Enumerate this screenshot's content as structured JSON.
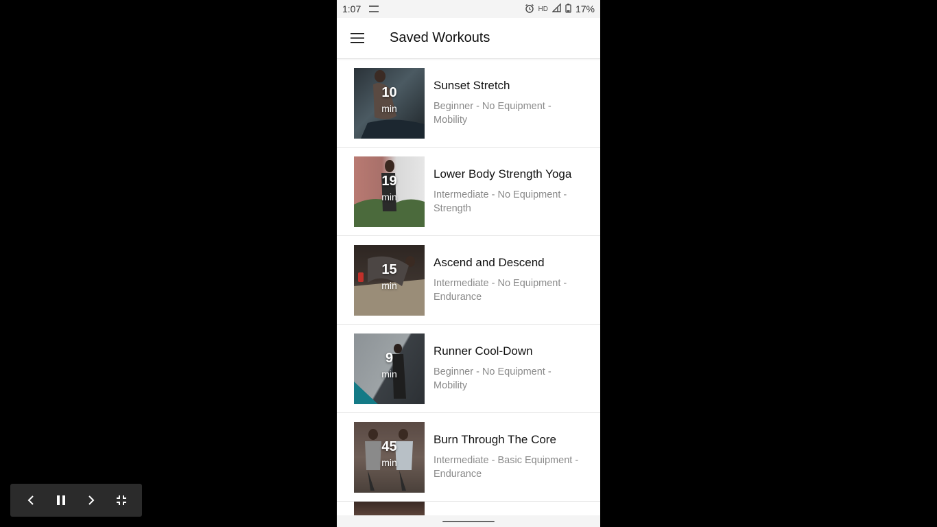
{
  "status_bar": {
    "time": "1:07",
    "battery": "17%",
    "hd": "HD"
  },
  "app_bar": {
    "title": "Saved Workouts"
  },
  "workouts": [
    {
      "duration": "10",
      "unit": "min",
      "name": "Sunset Stretch",
      "meta": "Beginner - No Equipment - Mobility"
    },
    {
      "duration": "19",
      "unit": "min",
      "name": "Lower Body Strength Yoga",
      "meta": "Intermediate - No Equipment - Strength"
    },
    {
      "duration": "15",
      "unit": "min",
      "name": "Ascend and Descend",
      "meta": "Intermediate - No Equipment - Endurance"
    },
    {
      "duration": "9",
      "unit": "min",
      "name": "Runner Cool-Down",
      "meta": "Beginner - No Equipment - Mobility"
    },
    {
      "duration": "45",
      "unit": "min",
      "name": "Burn Through The Core",
      "meta": "Intermediate - Basic Equipment - Endurance"
    }
  ],
  "icons": {
    "menu": "hamburger-icon",
    "alarm": "alarm-icon",
    "signal": "signal-icon",
    "battery": "battery-icon",
    "prev": "chevron-left-icon",
    "pause": "pause-icon",
    "next": "chevron-right-icon",
    "exit_fullscreen": "exit-fullscreen-icon"
  }
}
